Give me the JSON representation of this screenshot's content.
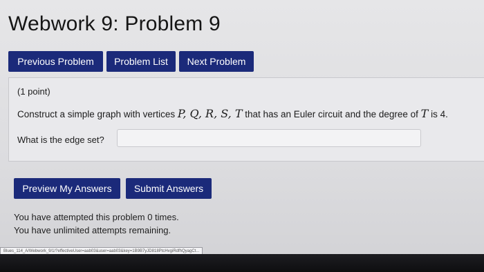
{
  "header": {
    "title": "Webwork 9: Problem 9"
  },
  "nav": {
    "previous_label": "Previous Problem",
    "list_label": "Problem List",
    "next_label": "Next Problem"
  },
  "problem": {
    "points": "(1 point)",
    "question_prefix": "Construct a simple graph with vertices ",
    "vertices": "P, Q, R, S, T",
    "question_middle": " that has an Euler circuit and the degree of ",
    "vertex_var": "T",
    "question_suffix": " is 4.",
    "edge_set_label": "What is the edge set?",
    "answer_value": ""
  },
  "actions": {
    "preview_label": "Preview My Answers",
    "submit_label": "Submit Answers"
  },
  "status": {
    "attempted": "You have attempted this problem 0 times.",
    "remaining": "You have unlimited attempts remaining."
  },
  "browser": {
    "status_url": "Blues_114_A/Webwork_9/1/?effectiveUser=aab03&user=aab03&key=1B9B7yJD818PtcHvgiRdfhQyagCt..."
  },
  "colors": {
    "button_bg": "#1b2a7a",
    "button_text": "#ffffff",
    "page_bg": "#e2e2e5"
  }
}
